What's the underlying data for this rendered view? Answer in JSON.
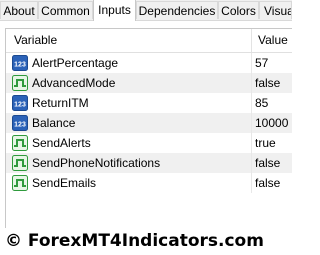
{
  "tabs": [
    {
      "label": "About"
    },
    {
      "label": "Common"
    },
    {
      "label": "Inputs"
    },
    {
      "label": "Dependencies"
    },
    {
      "label": "Colors"
    },
    {
      "label": "Visual"
    }
  ],
  "active_tab": "Inputs",
  "table": {
    "columns": {
      "variable": "Variable",
      "value": "Value"
    },
    "rows": [
      {
        "name": "AlertPercentage",
        "value": "57",
        "icon": "numeric-123-icon"
      },
      {
        "name": "AdvancedMode",
        "value": "false",
        "icon": "boolean-toggle-icon"
      },
      {
        "name": "ReturnITM",
        "value": "85",
        "icon": "numeric-123-icon"
      },
      {
        "name": "Balance",
        "value": "10000",
        "icon": "numeric-123-icon"
      },
      {
        "name": "SendAlerts",
        "value": "true",
        "icon": "boolean-toggle-icon"
      },
      {
        "name": "SendPhoneNotifications",
        "value": "false",
        "icon": "boolean-toggle-icon"
      },
      {
        "name": "SendEmails",
        "value": "false",
        "icon": "boolean-toggle-icon"
      }
    ]
  },
  "footer": {
    "watermark": "© ForexMT4Indicators.com"
  },
  "colors": {
    "numeric_icon": "#2b62b8",
    "boolean_icon": "#2e9a3c",
    "alt_row": "#f0f0f0"
  }
}
